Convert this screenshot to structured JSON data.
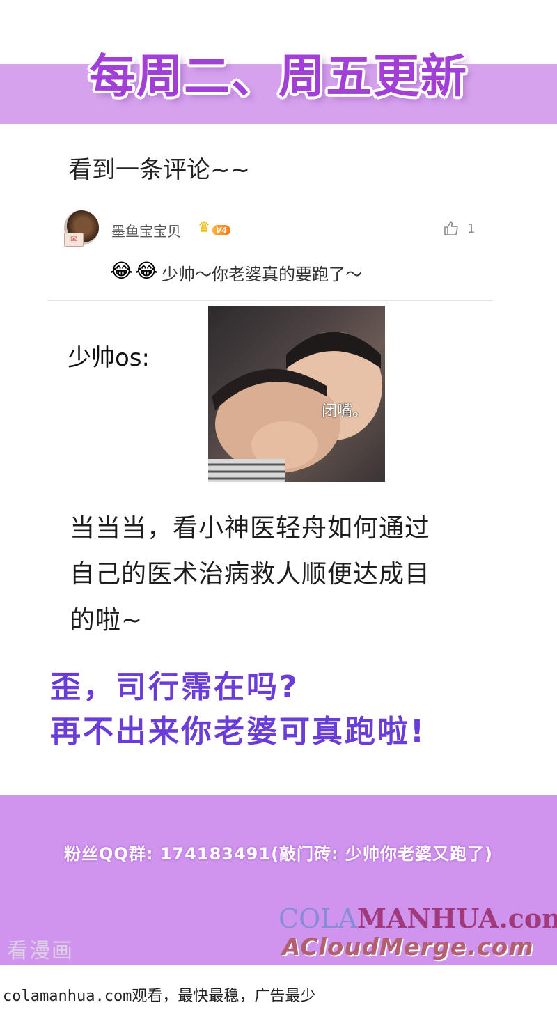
{
  "banner": {
    "title": "每周二、周五更新"
  },
  "comment_section": {
    "heading": "看到一条评论~~",
    "user": {
      "name": "墨鱼宝宝贝",
      "level_badge": "V4",
      "avatar_badge": "✉"
    },
    "likes": "1",
    "emojis": [
      "😂",
      "😂"
    ],
    "comment": "少帅～你老婆真的要跑了～"
  },
  "reaction": {
    "label": "少帅os:",
    "image_caption": "闭嘴。"
  },
  "story": {
    "line1": "当当当，看小神医轻舟如何通过",
    "line2": "自己的医术治病救人顺便达成目",
    "line3": "的啦~"
  },
  "call_out": {
    "line1": "歪，司行霈在吗?",
    "line2": "再不出来你老婆可真跑啦!"
  },
  "footer_banner": {
    "qq": "粉丝QQ群: 174183491(敲门砖: 少帅你老婆又跑了)",
    "watermark": "看漫画",
    "brand_part1": "COLA",
    "brand_part2": "MANHUA",
    "brand_part3": ".com",
    "brand_line2": "ACloudMerge.com"
  },
  "footer": {
    "text": "colamanhua.com观看，最快最稳，广告最少"
  },
  "colors": {
    "banner": "#d6a2ee",
    "title": "#a13fd6",
    "call_out": "#6a3cd8",
    "bottom_banner": "#cf94ee"
  },
  "icons": {
    "like": "thumbs-up-icon",
    "crown": "crown-icon"
  }
}
